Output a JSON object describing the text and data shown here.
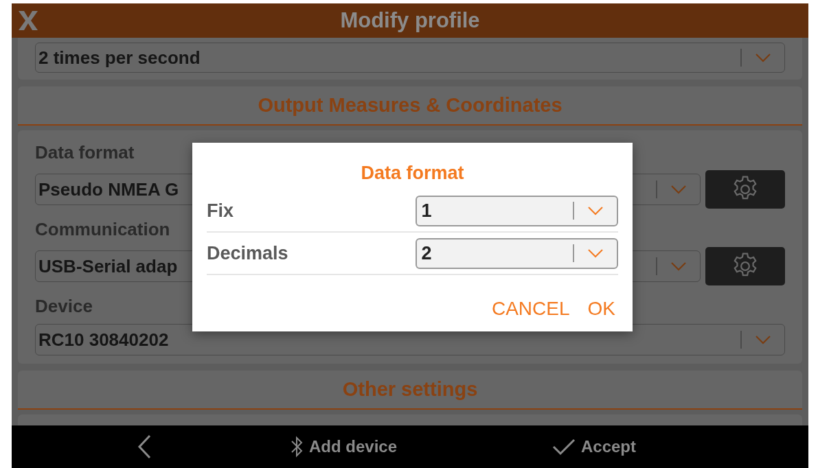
{
  "header": {
    "title": "Modify profile"
  },
  "rate_select": {
    "value": "2 times per second"
  },
  "sections": [
    {
      "title": "Output Measures & Coordinates",
      "fields": [
        {
          "label": "Data format",
          "value": "Pseudo NMEA G",
          "settings_button": true
        },
        {
          "label": "Communication",
          "value": "USB-Serial adap",
          "settings_button": true
        },
        {
          "label": "Device",
          "value": "RC10 30840202",
          "settings_button": false
        }
      ]
    },
    {
      "title": "Other settings"
    }
  ],
  "dialog": {
    "title": "Data format",
    "rows": [
      {
        "label": "Fix",
        "value": "1"
      },
      {
        "label": "Decimals",
        "value": "2"
      }
    ],
    "buttons": [
      "CANCEL",
      "OK"
    ]
  },
  "bottom_bar": {
    "items": [
      {
        "kind": "back"
      },
      {
        "kind": "bluetooth",
        "label": "Add device"
      },
      {
        "kind": "check",
        "label": "Accept"
      }
    ]
  }
}
